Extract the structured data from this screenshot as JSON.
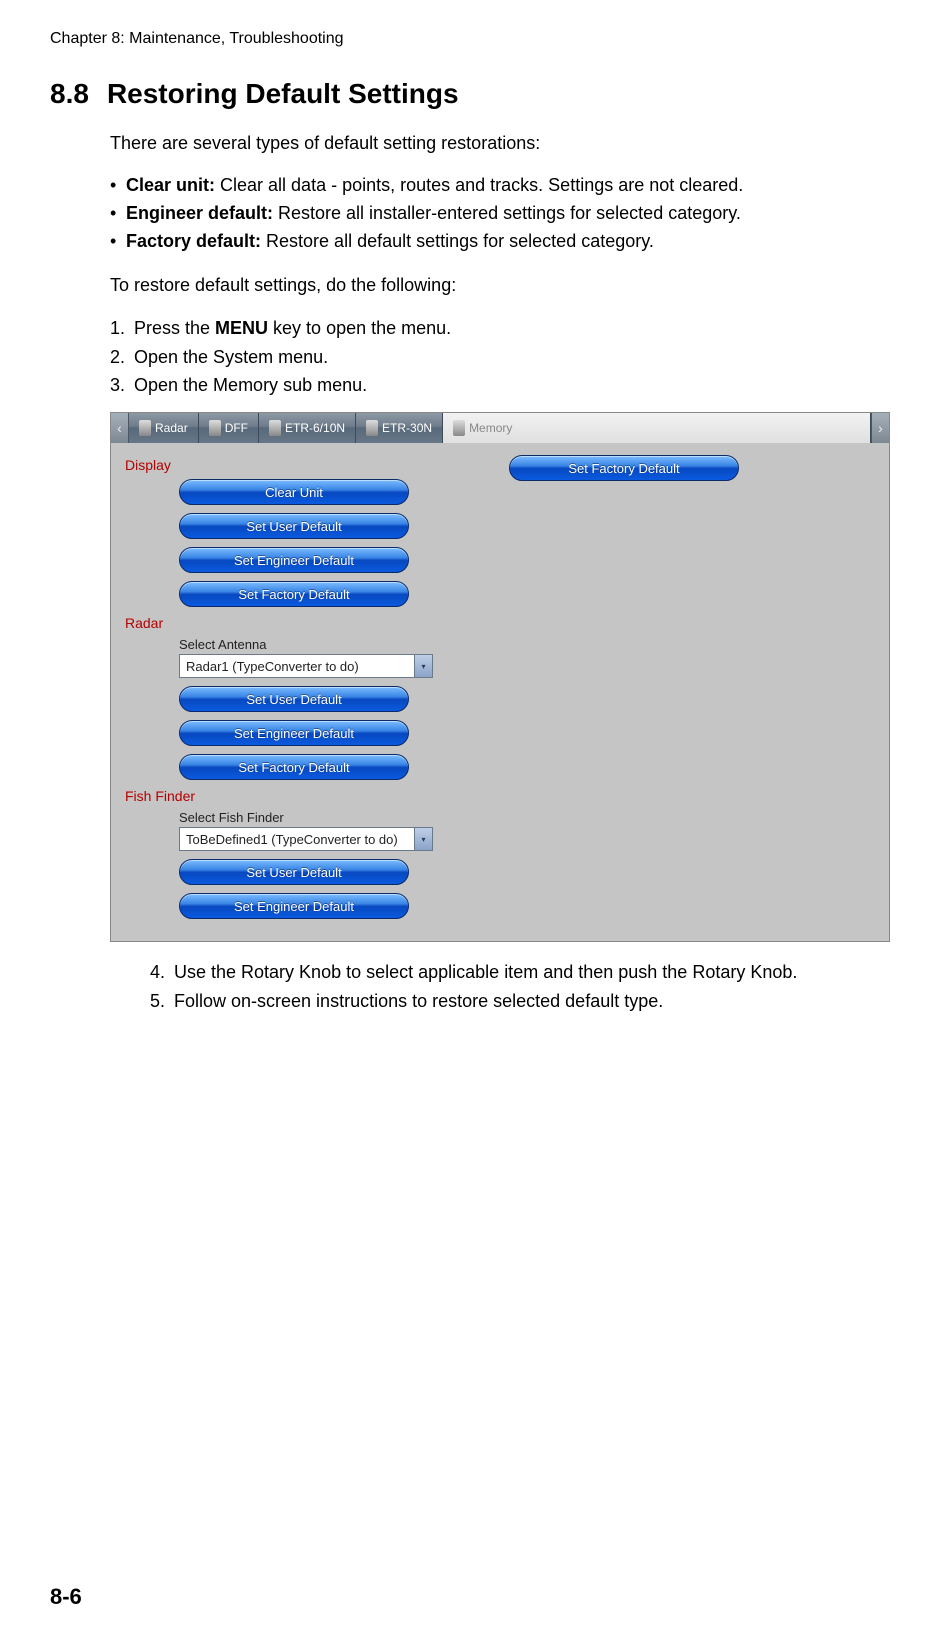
{
  "header": "Chapter 8: Maintenance, Troubleshooting",
  "section": {
    "num": "8.8",
    "title": "Restoring Default Settings"
  },
  "intro": "There are several types of default setting restorations:",
  "bullets": [
    {
      "term": "Clear unit:",
      "desc": " Clear all data - points, routes and tracks. Settings are not cleared."
    },
    {
      "term": "Engineer default:",
      "desc": " Restore all installer-entered settings for selected category."
    },
    {
      "term": "Factory default:",
      "desc": " Restore all default settings for selected category."
    }
  ],
  "lead2": "To restore default settings, do the following:",
  "steps_a": [
    {
      "pre": "Press the ",
      "bold": "MENU",
      "post": " key to open the menu."
    },
    {
      "pre": "Open the System menu.",
      "bold": "",
      "post": ""
    },
    {
      "pre": "Open the Memory sub menu.",
      "bold": "",
      "post": ""
    }
  ],
  "steps_b": [
    "Use the Rotary Knob to select applicable item and then push the Rotary Knob.",
    "Follow on-screen instructions to restore selected default type."
  ],
  "page_num": "8-6",
  "ui": {
    "tabs": [
      "Radar",
      "DFF",
      "ETR-6/10N",
      "ETR-30N",
      "Memory"
    ],
    "arrows": {
      "left": "‹",
      "right": "›"
    },
    "right_col_btn": "Set Factory Default",
    "groups": {
      "display": {
        "header": "Display",
        "buttons": [
          "Clear Unit",
          "Set User Default",
          "Set Engineer Default",
          "Set Factory Default"
        ]
      },
      "radar": {
        "header": "Radar",
        "field_label": "Select Antenna",
        "dropdown_value": "Radar1 (TypeConverter to do)",
        "buttons": [
          "Set User Default",
          "Set Engineer Default",
          "Set Factory Default"
        ]
      },
      "fish": {
        "header": "Fish Finder",
        "field_label": "Select Fish Finder",
        "dropdown_value": "ToBeDefined1 (TypeConverter to do)",
        "buttons": [
          "Set User Default",
          "Set Engineer Default"
        ]
      }
    }
  }
}
